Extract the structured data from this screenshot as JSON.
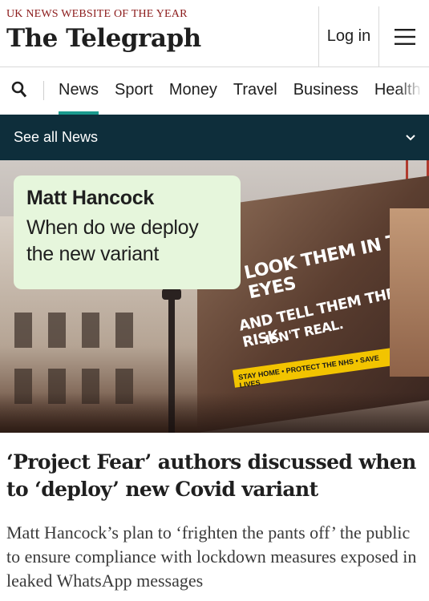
{
  "header": {
    "tagline": "UK NEWS WEBSITE OF THE YEAR",
    "masthead": "The Telegraph",
    "login_label": "Log in",
    "menu_icon": "hamburger-menu-icon"
  },
  "nav": {
    "search_icon": "search-icon",
    "items": [
      {
        "label": "News",
        "active": true
      },
      {
        "label": "Sport"
      },
      {
        "label": "Money"
      },
      {
        "label": "Travel"
      },
      {
        "label": "Business"
      },
      {
        "label": "Health"
      }
    ]
  },
  "section_bar": {
    "label": "See all News",
    "icon": "chevron-down-icon"
  },
  "hero": {
    "card_sender": "Matt Hancock",
    "card_message": "When do we deploy the new variant",
    "billboard_lines": [
      "LOOK THEM IN THE EYES",
      "AND TELL THEM THE RISK",
      "ISN'T REAL."
    ],
    "billboard_strip": "STAY HOME • PROTECT THE NHS • SAVE LIVES",
    "colors": {
      "card_bg": "#e6f6dc",
      "strip": "#f2c400"
    }
  },
  "article": {
    "headline": "‘Project Fear’ authors discussed when to ‘deploy’ new Covid variant",
    "standfirst": "Matt Hancock’s plan to ‘frighten the pants off’ the public to ensure compliance with lockdown measures exposed in leaked WhatsApp messages"
  },
  "colors": {
    "accent": "#1a9a8e",
    "section_bar": "#0e2e3b",
    "tagline": "#8b1a1a"
  }
}
